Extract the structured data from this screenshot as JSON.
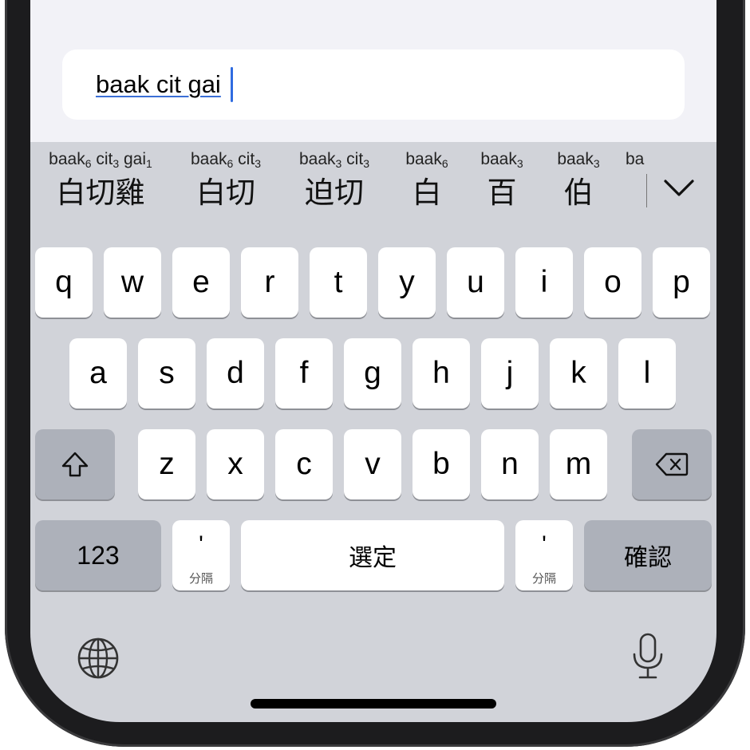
{
  "text_field": {
    "value": "baak cit gai"
  },
  "candidates": [
    {
      "jyutping": [
        "baak",
        "6",
        " cit",
        "3",
        " gai",
        "1"
      ],
      "hanzi": "白切雞"
    },
    {
      "jyutping": [
        "baak",
        "6",
        " cit",
        "3"
      ],
      "hanzi": "白切"
    },
    {
      "jyutping": [
        "baak",
        "3",
        " cit",
        "3"
      ],
      "hanzi": "迫切"
    },
    {
      "jyutping": [
        "baak",
        "6"
      ],
      "hanzi": "白"
    },
    {
      "jyutping": [
        "baak",
        "3"
      ],
      "hanzi": "百"
    },
    {
      "jyutping": [
        "baak",
        "3"
      ],
      "hanzi": "伯"
    },
    {
      "jyutping": [
        "ba",
        ""
      ],
      "hanzi": ""
    }
  ],
  "keyboard": {
    "row1": [
      "q",
      "w",
      "e",
      "r",
      "t",
      "y",
      "u",
      "i",
      "o",
      "p"
    ],
    "row2": [
      "a",
      "s",
      "d",
      "f",
      "g",
      "h",
      "j",
      "k",
      "l"
    ],
    "row3": [
      "z",
      "x",
      "c",
      "v",
      "b",
      "n",
      "m"
    ],
    "numbers_label": "123",
    "separator_symbol": "'",
    "separator_label": "分隔",
    "space_label": "選定",
    "return_label": "確認"
  },
  "icons": {
    "shift": "shift-icon",
    "delete": "delete-icon",
    "globe": "globe-icon",
    "mic": "microphone-icon",
    "expand": "chevron-down-icon"
  }
}
